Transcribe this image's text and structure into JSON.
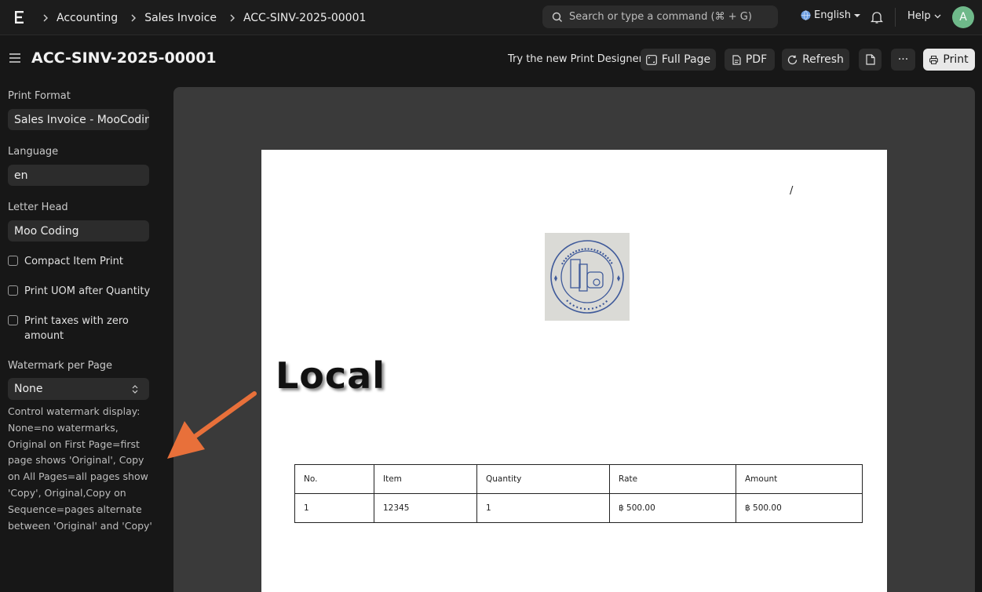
{
  "navbar": {
    "breadcrumbs": [
      "Accounting",
      "Sales Invoice",
      "ACC-SINV-2025-00001"
    ],
    "search_placeholder": "Search or type a command (⌘ + G)",
    "language": "English",
    "help_label": "Help",
    "avatar_initial": "A"
  },
  "header": {
    "title": "ACC-SINV-2025-00001",
    "designer_link": "Try the new Print Designer",
    "buttons": {
      "full_page": "Full Page",
      "pdf": "PDF",
      "refresh": "Refresh",
      "more": "···",
      "print": "Print"
    }
  },
  "sidebar": {
    "print_format_label": "Print Format",
    "print_format_value": "Sales Invoice - MooCoding",
    "language_label": "Language",
    "language_value": "en",
    "letter_head_label": "Letter Head",
    "letter_head_value": "Moo Coding",
    "checkboxes": [
      {
        "label": "Compact Item Print",
        "checked": false
      },
      {
        "label": "Print UOM after Quantity",
        "checked": false
      },
      {
        "label": "Print taxes with zero amount",
        "checked": false
      }
    ],
    "watermark_label": "Watermark per Page",
    "watermark_value": "None",
    "watermark_help": "Control watermark display: None=no watermarks, Original on First Page=first page shows 'Original', Copy on All Pages=all pages show 'Copy', Original,Copy on Sequence=pages alternate between 'Original' and 'Copy'"
  },
  "document": {
    "slash": "/",
    "heading": "Local",
    "table": {
      "headers": [
        "No.",
        "Item",
        "Quantity",
        "Rate",
        "Amount"
      ],
      "rows": [
        [
          "1",
          "12345",
          "1",
          "฿ 500.00",
          "฿ 500.00"
        ]
      ]
    }
  },
  "colors": {
    "background": "#171717",
    "preview_area": "#3a3a3a",
    "arrow": "#e8703a",
    "avatar": "#6fb98a"
  }
}
